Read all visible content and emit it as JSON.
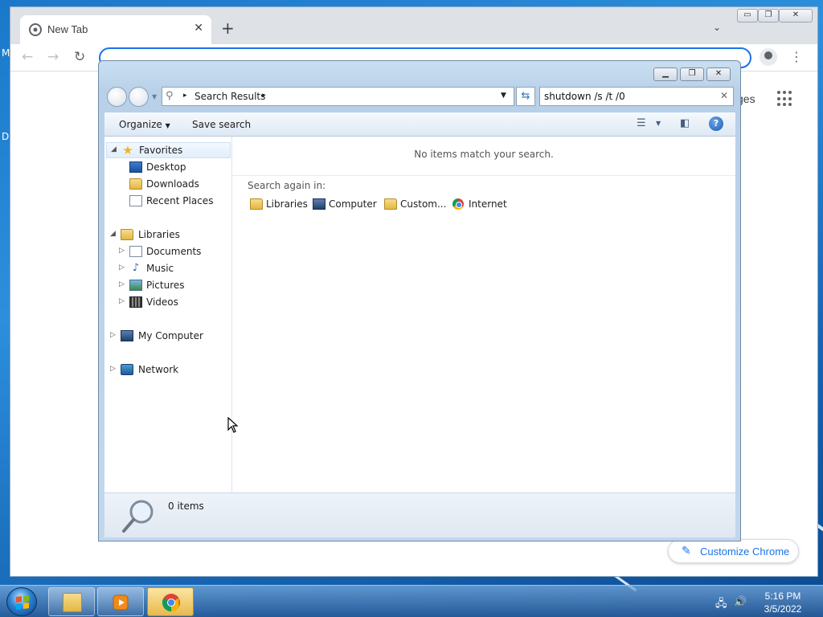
{
  "chrome": {
    "tab_title": "New Tab",
    "tab_close": "✕",
    "new_tab": "+",
    "tab_search": "⌄",
    "win_min": "▭",
    "win_max": "❐",
    "win_close": "✕",
    "back": "←",
    "forward": "→",
    "reload": "↻",
    "menu": "⋮",
    "images_link_partial": "ges",
    "customize_label": "Customize Chrome",
    "accent_color": "#1a73e8"
  },
  "explorer": {
    "address": {
      "crumb": "Search Results",
      "sep": "▸"
    },
    "search_value": "shutdown /s /t /0",
    "clear_glyph": "✕",
    "command_bar": {
      "organize": "Organize",
      "save_search": "Save search"
    },
    "nav_pane": {
      "favorites": "Favorites",
      "desktop": "Desktop",
      "downloads": "Downloads",
      "recent_places": "Recent Places",
      "libraries": "Libraries",
      "documents": "Documents",
      "music": "Music",
      "pictures": "Pictures",
      "videos": "Videos",
      "my_computer": "My Computer",
      "network": "Network"
    },
    "content": {
      "empty_message": "No items match your search.",
      "search_again_label": "Search again in:",
      "search_again_items": [
        "Libraries",
        "Computer",
        "Custom...",
        "Internet"
      ]
    },
    "details": {
      "item_count": "0 items"
    }
  },
  "taskbar": {
    "time": "5:16 PM",
    "date": "3/5/2022",
    "apps": [
      "windows-explorer",
      "media-player",
      "google-chrome"
    ]
  },
  "desktop": {
    "left_edge_chars": [
      "M",
      "D"
    ]
  }
}
